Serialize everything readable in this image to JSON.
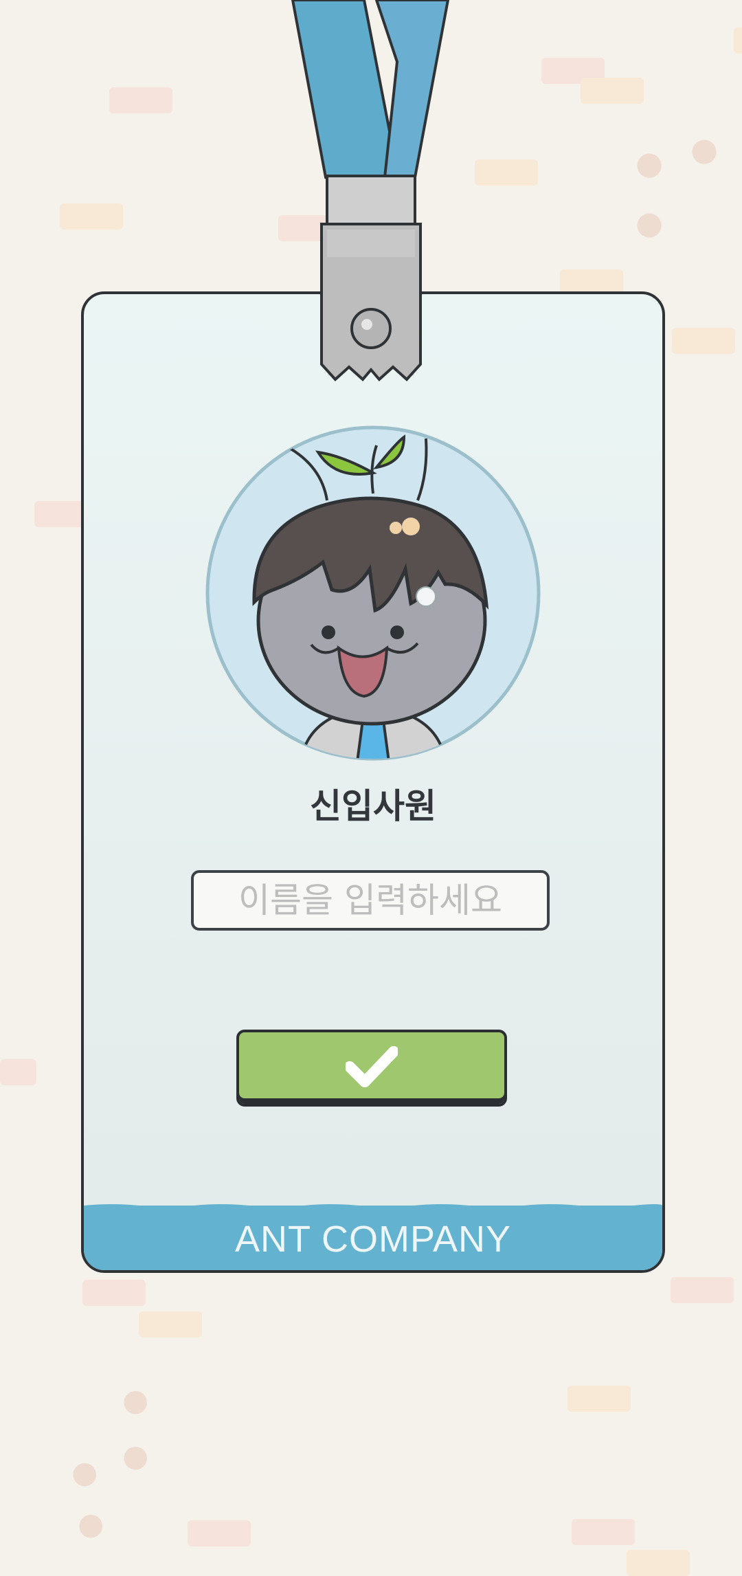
{
  "card": {
    "role_title": "신입사원",
    "name_placeholder": "이름을 입력하세요",
    "name_value": "",
    "company_name": "ANT COMPANY"
  },
  "icons": {
    "confirm": "checkmark-icon",
    "avatar": "ant-employee-avatar",
    "clip": "lanyard-clip",
    "decoration": "paw-print-icon"
  },
  "colors": {
    "background": "#f5f2ec",
    "card": "#e8f1f0",
    "lanyard": "#5fabcc",
    "footer": "#63b3d0",
    "confirm_button": "#9fc86e",
    "avatar_bg": "#cfe6f0"
  }
}
